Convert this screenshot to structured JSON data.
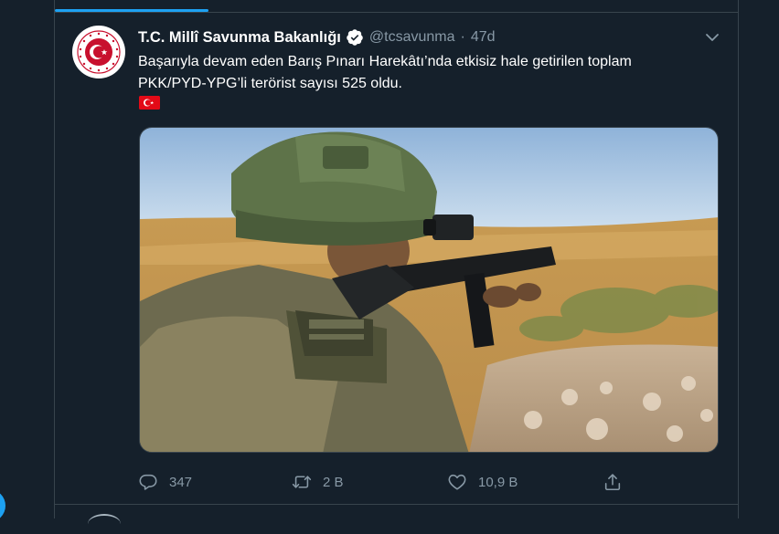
{
  "tweet": {
    "display_name": "T.C. Millî Savunma Bakanlığı",
    "handle": "@tcsavunma",
    "separator": "·",
    "time": "47d",
    "text_line1": "Başarıyla devam eden Barış Pınarı Harekâtı’nda etkisiz hale getirilen toplam",
    "text_line2": "PKK/PYD-YPG’li terörist sayısı 525 oldu.",
    "flag_emoji": "turkey-flag-icon",
    "media_alt": "photo",
    "stats": {
      "replies": "347",
      "retweets": "2 B",
      "likes": "10,9 B"
    }
  },
  "colors": {
    "background": "#15202b",
    "border": "#38444d",
    "accent": "#1da1f2",
    "secondary_text": "#8899a6",
    "flag_red": "#e30a17",
    "seal_red": "#c8102e"
  },
  "icons": {
    "verified": "verified-badge-icon",
    "caret": "chevron-down-icon",
    "reply": "reply-icon",
    "retweet": "retweet-icon",
    "like": "heart-icon",
    "share": "share-icon"
  }
}
